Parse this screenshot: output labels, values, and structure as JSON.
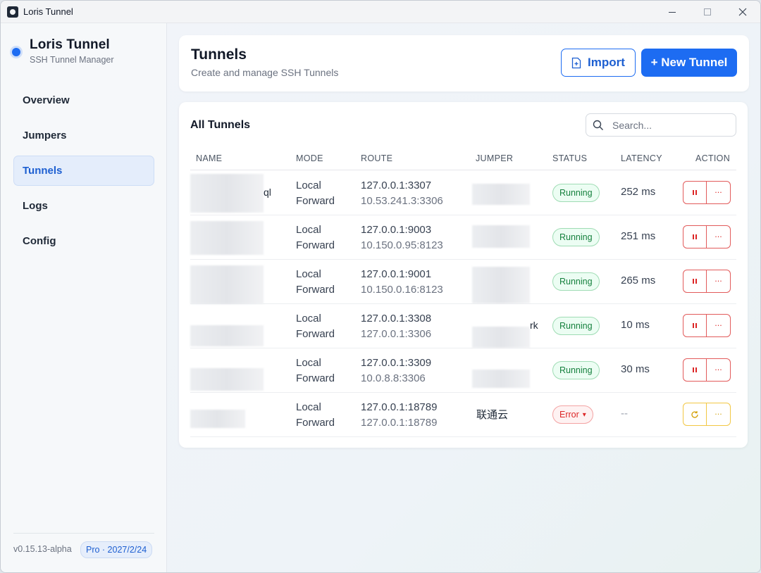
{
  "window": {
    "title": "Loris Tunnel"
  },
  "sidebar": {
    "brand_title": "Loris Tunnel",
    "brand_sub": "SSH Tunnel Manager",
    "items": [
      {
        "label": "Overview"
      },
      {
        "label": "Jumpers"
      },
      {
        "label": "Tunnels"
      },
      {
        "label": "Logs"
      },
      {
        "label": "Config"
      }
    ],
    "active_item": "Tunnels",
    "version": "v0.15.13-alpha",
    "plan": "Pro · 2027/2/24"
  },
  "header": {
    "title": "Tunnels",
    "subtitle": "Create and manage SSH Tunnels",
    "import_label": "Import",
    "new_label": "+ New Tunnel"
  },
  "table": {
    "title": "All Tunnels",
    "search_placeholder": "Search...",
    "columns": [
      "NAME",
      "MODE",
      "ROUTE",
      "JUMPER",
      "STATUS",
      "LATENCY",
      "ACTION"
    ],
    "rows": [
      {
        "name_tail": "ql",
        "mode1": "Local",
        "mode2": "Forward",
        "route1": "127.0.0.1:3307",
        "route2": "10.53.241.3:3306",
        "jumper": "",
        "jumper_tail": "",
        "status": "Running",
        "latency": "252 ms"
      },
      {
        "name_tail": "",
        "mode1": "Local",
        "mode2": "Forward",
        "route1": "127.0.0.1:9003",
        "route2": "10.150.0.95:8123",
        "jumper": "",
        "jumper_tail": "",
        "status": "Running",
        "latency": "251 ms"
      },
      {
        "name_tail": "",
        "mode1": "Local",
        "mode2": "Forward",
        "route1": "127.0.0.1:9001",
        "route2": "10.150.0.16:8123",
        "jumper": "",
        "jumper_tail": "",
        "status": "Running",
        "latency": "265 ms"
      },
      {
        "name_tail": "",
        "mode1": "Local",
        "mode2": "Forward",
        "route1": "127.0.0.1:3308",
        "route2": "127.0.0.1:3306",
        "jumper": "",
        "jumper_tail": "rk",
        "status": "Running",
        "latency": "10 ms"
      },
      {
        "name_tail": "",
        "mode1": "Local",
        "mode2": "Forward",
        "route1": "127.0.0.1:3309",
        "route2": "10.0.8.8:3306",
        "jumper": "",
        "jumper_tail": "",
        "status": "Running",
        "latency": "30 ms"
      },
      {
        "name_tail": "",
        "mode1": "Local",
        "mode2": "Forward",
        "route1": "127.0.0.1:18789",
        "route2": "127.0.0.1:18789",
        "jumper": "联通云",
        "jumper_tail": "",
        "status": "Error",
        "latency": "--"
      }
    ]
  },
  "icons": {
    "pause": "pause-icon",
    "more": "more-icon",
    "restart": "refresh-icon",
    "chevron": "▾"
  },
  "colors": {
    "accent": "#1d6cf2",
    "running": "#15803d",
    "error": "#dc2626",
    "warning": "#f2c744"
  }
}
